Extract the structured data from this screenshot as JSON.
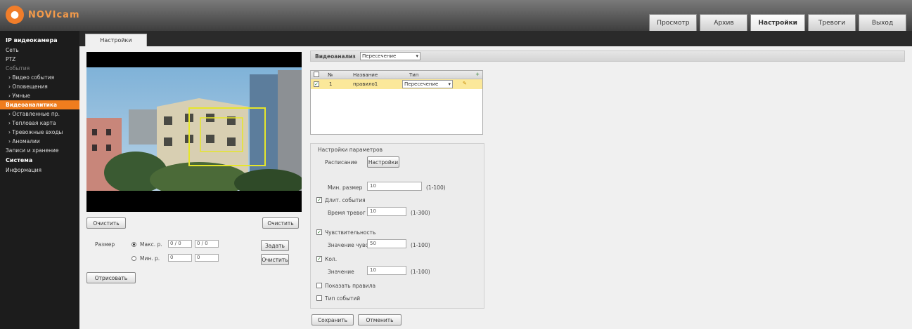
{
  "header": {
    "logo_mark": "●",
    "logo_text": "NOVIcam",
    "tabs": [
      {
        "label": "Просмотр",
        "active": false
      },
      {
        "label": "Архив",
        "active": false
      },
      {
        "label": "Настройки",
        "active": true
      },
      {
        "label": "Тревоги",
        "active": false
      },
      {
        "label": "Выход",
        "active": false
      }
    ]
  },
  "sidebar": {
    "items": [
      {
        "label": "IP видеокамера",
        "kind": "header"
      },
      {
        "label": "Сеть",
        "kind": "item"
      },
      {
        "label": "PTZ",
        "kind": "item"
      },
      {
        "label": "События",
        "kind": "muted"
      },
      {
        "label": "› Видео события",
        "kind": "sub"
      },
      {
        "label": "› Оповещения",
        "kind": "sub"
      },
      {
        "label": "› Умные",
        "kind": "sub"
      },
      {
        "label": "Видеоаналитика",
        "kind": "active"
      },
      {
        "label": "› Оставленные пр.",
        "kind": "sub"
      },
      {
        "label": "› Тепловая карта",
        "kind": "sub"
      },
      {
        "label": "› Тревожные входы",
        "kind": "sub"
      },
      {
        "label": "› Аномалии",
        "kind": "sub"
      },
      {
        "label": "Записи и хранение",
        "kind": "item"
      },
      {
        "label": "Система",
        "kind": "header"
      },
      {
        "label": "Информация",
        "kind": "item"
      }
    ]
  },
  "subtab": {
    "label": "Настройки"
  },
  "preview": {
    "left_button": "Очистить",
    "right_button": "Очистить",
    "range_label": "Размер",
    "max_label": "Макс. р.",
    "min_label": "Мин. р.",
    "max_w": "0 / 0",
    "max_h": "0 / 0",
    "min_w": "0",
    "min_h": "0",
    "set_button": "Задать",
    "clear_button": "Очистить",
    "draw_button": "Отрисовать"
  },
  "toolbar": {
    "label": "Видеоанализ",
    "select_value": "Пересечение"
  },
  "rules_table": {
    "headers": [
      "№",
      "Название",
      "Тип"
    ],
    "rows": [
      {
        "checked": true,
        "num": "1",
        "name": "правило1",
        "type": "Пересечение"
      }
    ]
  },
  "settings": {
    "group_title": "Настройки параметров",
    "schedule_label": "Расписание",
    "schedule_button": "Настройки",
    "min_size_label": "Мин. размер",
    "min_size_value": "10",
    "min_size_range": "(1-100)",
    "duration_label": "Длит. события",
    "duration_checked": true,
    "time_label": "Время тревог",
    "time_value": "10",
    "time_range": "(1-300)",
    "sensitivity_check_label": "Чувствительность",
    "sensitivity_checked": true,
    "sensitivity_label": "Значение чувств.",
    "sensitivity_value": "50",
    "sensitivity_range": "(1-100)",
    "fps_check_label": "Кол.",
    "fps_checked": true,
    "fps_label": "Значение",
    "fps_value": "10",
    "fps_range": "(1-100)",
    "show_rule_label": "Показать правила",
    "show_rule_checked": false,
    "record_label": "Тип событий",
    "record_checked": false,
    "save_button": "Сохранить",
    "reset_button": "Отменить"
  }
}
